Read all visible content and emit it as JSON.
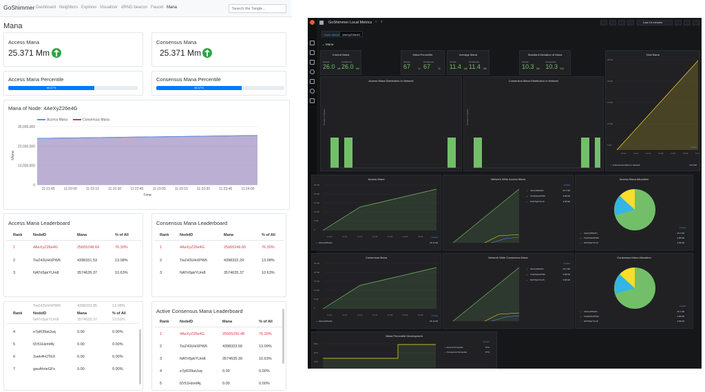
{
  "left": {
    "brand": "GoShimmer",
    "nav": [
      "Dashboard",
      "Neighbors",
      "Explorer",
      "Visualizer",
      "dRNG beacon",
      "Faucet",
      "Mana"
    ],
    "search_placeholder": "Search the Tangle...",
    "page_title": "Mana",
    "access_mana": {
      "label": "Access Mana",
      "value": "25.371 Mm"
    },
    "consensus_mana": {
      "label": "Consensus Mana",
      "value": "25.371 Mm"
    },
    "access_pct": {
      "label": "Access Mana Percentile",
      "bar": "66.67%",
      "fraction": 0.6667
    },
    "consensus_pct": {
      "label": "Consensus Mana Percentile",
      "bar": "66.67%",
      "fraction": 0.6667
    },
    "node_chart_title": "Mana of Node: 4AeXyZ26e4G",
    "access_leaderboard": {
      "title": "Access Mana Leaderboard",
      "headers": [
        "Rank",
        "NodeID",
        "Mana",
        "% of All"
      ],
      "rows": [
        [
          "1",
          "4AeXyZ26e4G",
          "25665248.64",
          "76.30%"
        ],
        [
          "2",
          "TwZ43UHXPW6",
          "4398331.53",
          "13.08%"
        ],
        [
          "3",
          "NATri5pkYUm8",
          "3574635.37",
          "10.63%"
        ]
      ]
    },
    "consensus_leaderboard": {
      "title": "Consensus Mana Leaderboard",
      "headers": [
        "Rank",
        "NodeID",
        "Mana",
        "% of All"
      ],
      "rows": [
        [
          "1",
          "4AeXyZ26e4G",
          "25665249.60",
          "76.30%"
        ],
        [
          "2",
          "TwZ43UHXPW6",
          "4398332.29",
          "13.08%"
        ],
        [
          "3",
          "NATri5pkYUm8",
          "3574635.37",
          "10.63%"
        ]
      ]
    },
    "active_access_list": {
      "partial_row": [
        "",
        "TwZ43UHXPW6",
        "4398332.85",
        "13.08%"
      ],
      "headers": [
        "Rank",
        "NodeID",
        "Mana",
        "% of All"
      ],
      "partial_row2": [
        "",
        "NATri5pkYUm8",
        "3574635.37",
        "10.63%"
      ],
      "rows": [
        [
          "4",
          "e7pR39atJuq",
          "0.00",
          "0.00%"
        ],
        [
          "5",
          "fZr51HzmfAj",
          "0.00",
          "0.00%"
        ],
        [
          "6",
          "2uek4HJTEX",
          "0.00",
          "0.00%"
        ],
        [
          "7",
          "gavAhrieGFs",
          "0.00",
          "0.00%"
        ]
      ]
    },
    "active_consensus_leaderboard": {
      "title": "Active Consensus Mana Leaderboard",
      "headers": [
        "Rank",
        "NodeID",
        "Mana",
        "% of All"
      ],
      "rows": [
        [
          "1",
          "4AeXyZ26e4G",
          "25665250.48",
          "76.30%"
        ],
        [
          "2",
          "TwZ43UHXPW6",
          "4398333.56",
          "13.09%"
        ],
        [
          "3",
          "NATri5pkYUm8",
          "3574635.39",
          "10.63%"
        ],
        [
          "4",
          "e7pR39atJuq",
          "0.00",
          "0.00%"
        ],
        [
          "5",
          "fZr51HzmfAj",
          "0.00",
          "0.00%"
        ]
      ]
    }
  },
  "chart_data": {
    "type": "area",
    "title": "Mana of Node: 4AeXyZ26e4G",
    "xlabel": "Time",
    "ylabel": "Mana",
    "x": [
      "11:21:45",
      "11:22:00",
      "11:22:15",
      "11:22:30",
      "11:22:45",
      "11:23:00",
      "11:23:15",
      "11:23:30",
      "11:23:45",
      "11:24:00"
    ],
    "yticks": [
      "0",
      "10,000,000",
      "20,000,000",
      "30,000,000"
    ],
    "ylim": [
      0,
      30000000
    ],
    "legend_position": "top",
    "series": [
      {
        "name": "Access Mana",
        "color": "#5794f2",
        "values": [
          24000000,
          24150000,
          24300000,
          24450000,
          24600000,
          24750000,
          24900000,
          25050000,
          25200000,
          25371000
        ]
      },
      {
        "name": "Consensus Mana",
        "color": "#dc3545",
        "values": [
          24000000,
          24150000,
          24300000,
          24450000,
          24600000,
          24750000,
          24900000,
          25050000,
          25200000,
          25371000
        ]
      }
    ]
  },
  "grafana": {
    "title": "GoShimmer Local Metrics",
    "time_range": "Last 15 minutes",
    "var_label": "Node Identity",
    "var_value": "4AeXyZ26e4G",
    "row_title": "Mana",
    "stats": {
      "current": {
        "title": "Current Mana",
        "sub1": "Access",
        "v1": "26.0",
        "u1": "Mil",
        "sub2": "Consensus",
        "v2": "26.0",
        "u2": "Mil"
      },
      "percentile": {
        "title": "Mana Percentile",
        "sub1": "Access",
        "v1": "67",
        "u1": "%",
        "sub2": "Consensus",
        "v2": "67",
        "u2": "%"
      },
      "average": {
        "title": "Average Mana",
        "sub1": "Access",
        "v1": "11.4",
        "u1": "Mil",
        "sub2": "Consensus",
        "v2": "11.4",
        "u2": "Mil"
      },
      "stddev": {
        "title": "Standard Deviation of Mana",
        "sub1": "Access",
        "v1": "10.3",
        "u1": "Mil",
        "sub2": "Consensus",
        "v2": "10.3",
        "u2": "Mil"
      }
    },
    "total_mana": {
      "title": "Total Mana",
      "legend": "Total Access Mana in Network",
      "current_label": "current",
      "current": "34.2 Mil",
      "yticks": [
        "25 Mil",
        "20 Mil",
        "15 Mil",
        "10 Mil",
        "5 Mil"
      ],
      "xticks": [
        "11:12",
        "11:14",
        "11:16",
        "11:18",
        "11:20",
        "11:22",
        "11:24"
      ]
    },
    "access_dist": {
      "title": "Access Mana Distribution In Network",
      "ylabel": "Number of Nodes"
    },
    "consensus_dist": {
      "title": "Consensus Mana Distribution In Network",
      "ylabel": "Number of Nodes"
    },
    "access_mana": {
      "title": "Access Mana",
      "legend": "4AeXyZ26e4G",
      "current_label": "current",
      "current": "26.11 Mil",
      "yticks": [
        "25 Mil",
        "20 Mil",
        "15 Mil",
        "10 Mil",
        "5 Mil",
        "0"
      ],
      "xticks": [
        "11:12",
        "11:14",
        "11:16",
        "11:18",
        "11:20",
        "11:22",
        "11:24"
      ]
    },
    "network_access": {
      "title": "Network Wide Access Mana",
      "legend": [
        {
          "name": "4AeXyZ26e4G",
          "value": "26.1 Mil",
          "color": "#73bf69"
        },
        {
          "name": "TwZ43UHXPW6",
          "value": "4.88 Mil",
          "color": "#fade2a"
        },
        {
          "name": "NATri5pkYUm8",
          "value": "3.58 Mil",
          "color": "#5794f2"
        }
      ],
      "current_label": "current"
    },
    "access_alloc": {
      "title": "Access Mana Allocation",
      "legend": [
        {
          "name": "4AeXyZ26e4G",
          "value": "26.1 Mil",
          "color": "#73bf69"
        },
        {
          "name": "TwZ43UHXPW6",
          "value": "4.88 Mil",
          "color": "#fade2a"
        },
        {
          "name": "NATri5pkYUm8",
          "value": "3.58 Mil",
          "color": "#5794f2"
        }
      ],
      "current_label": "current"
    },
    "consensus_mana": {
      "title": "Consensus Mana",
      "legend": "4AeXyZ26e4G",
      "current_label": "current",
      "current": "26.11 Mil",
      "yticks": [
        "25 Mil",
        "20 Mil",
        "15 Mil",
        "10 Mil",
        "5 Mil",
        "0"
      ],
      "xticks": [
        "11:12",
        "11:14",
        "11:16",
        "11:18",
        "11:20",
        "11:22",
        "11:24"
      ]
    },
    "network_consensus": {
      "title": "Network Wide Consensus Mana",
      "legend": [
        {
          "name": "4AeXyZ26e4G",
          "value": "26.1 Mil",
          "color": "#73bf69"
        },
        {
          "name": "TwZ43UHXPW6",
          "value": "4.88 Mil",
          "color": "#fade2a"
        },
        {
          "name": "NATri5pkYUm8",
          "value": "3.58 Mil",
          "color": "#5794f2"
        }
      ],
      "current_label": "current"
    },
    "consensus_alloc": {
      "title": "Consensus Mana Allocation",
      "legend": [
        {
          "name": "4AeXyZ26e4G",
          "value": "26.1 Mil",
          "color": "#73bf69"
        },
        {
          "name": "TwZ43UHXPW6",
          "value": "4.88 Mil",
          "color": "#fade2a"
        },
        {
          "name": "NATri5pkYUm8",
          "value": "3.58 Mil",
          "color": "#5794f2"
        }
      ],
      "current_label": "current"
    },
    "percentile_dev": {
      "title": "Mana Percentile Development",
      "yticks": [
        "80%",
        "60%",
        "40%"
      ],
      "legend": [
        {
          "name": "Access Percentile",
          "value": "67%"
        },
        {
          "name": "Consensus Percentile",
          "value": "67%"
        }
      ],
      "current_label": "current"
    }
  }
}
